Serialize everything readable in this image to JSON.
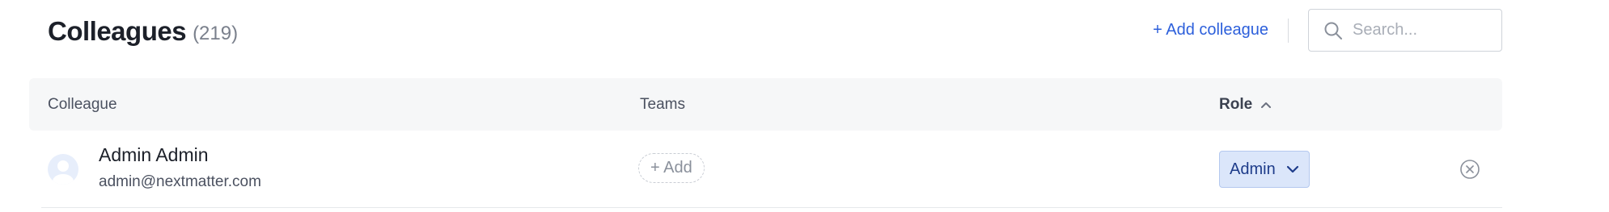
{
  "header": {
    "title": "Colleagues",
    "count": "(219)",
    "add_label": "+ Add colleague",
    "search_placeholder": "Search..."
  },
  "table": {
    "columns": {
      "colleague": "Colleague",
      "teams": "Teams",
      "role": "Role"
    },
    "sort": {
      "column": "role",
      "direction": "ascending",
      "icon": "chevron-up-icon"
    },
    "rows": [
      {
        "name": "Admin Admin",
        "email": "admin@nextmatter.com",
        "teams_add_label": "+ Add",
        "role": "Admin",
        "avatar_icon": "user-avatar-icon",
        "remove_icon": "remove-circle-icon"
      }
    ]
  },
  "colors": {
    "accent": "#2c5fdb",
    "role_bg": "#dbe6fa",
    "role_border": "#b4c8ef",
    "role_text": "#1e3c8a",
    "header_bg": "#f6f7f8"
  }
}
